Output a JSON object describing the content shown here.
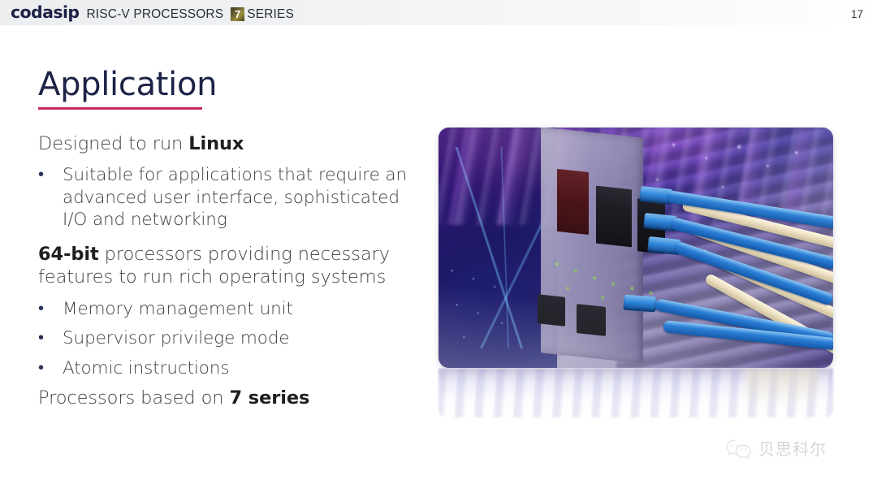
{
  "header": {
    "logo_text": "codasip",
    "product_label": "RISC-V PROCESSORS",
    "series_number": "7",
    "series_word": "SERIES",
    "page_number": "17"
  },
  "slide": {
    "title": "Application",
    "lead_1_prefix": "Designed to run ",
    "lead_1_bold": "Linux",
    "bullets_group_1": [
      "Suitable for applications that require an advanced user interface, sophisticated I/O and networking"
    ],
    "lead_2_bold": "64-bit",
    "lead_2_suffix": " processors providing necessary features to run rich operating systems",
    "bullets_group_2": [
      "Memory management unit",
      "Supervisor privilege mode",
      "Atomic instructions"
    ],
    "lead_3_prefix": "Processors based on ",
    "lead_3_bold": "7 series",
    "bullet_marker": "•"
  },
  "media": {
    "photo_alt": "network-switch-photo"
  },
  "watermark": {
    "icon": "wechat-icon",
    "text": "贝思科尔"
  },
  "colors": {
    "brand_navy": "#1d2346",
    "accent_crimson": "#c92a5e",
    "body_gray": "#3f3f3f",
    "badge_gold": "#9c8f3e",
    "watermark_gray": "#d2d2d2"
  }
}
